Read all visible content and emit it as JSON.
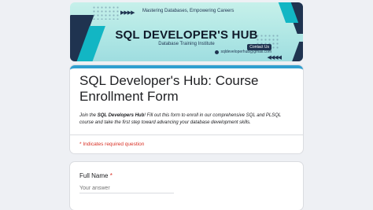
{
  "banner": {
    "tagline": "Mastering Databases, Empowering Careers",
    "title": "SQL DEVELOPER'S HUB",
    "subtitle": "Database Training Institute",
    "contact_label": "Contact Us",
    "email": "sqldeveloperhub@gmail.com",
    "arrows_left": "▶▶▶▶",
    "arrows_right": "◀◀◀◀"
  },
  "form": {
    "title": "SQL Developer's Hub: Course Enrollment Form",
    "description_prefix": "Join the ",
    "description_brand": "SQL Developers Hub",
    "description_suffix": "! Fill out this form to enroll in our comprehensive SQL and PLSQL course and take the first step toward advancing your database development skills.",
    "required_note": "* Indicates required question"
  },
  "questions": [
    {
      "label": "Full Name",
      "required_mark": "*",
      "placeholder": "Your answer"
    }
  ],
  "colors": {
    "accent": "#2f9fd0",
    "banner_dark": "#1f3350",
    "banner_teal": "#12b6c4",
    "required": "#d93025"
  }
}
